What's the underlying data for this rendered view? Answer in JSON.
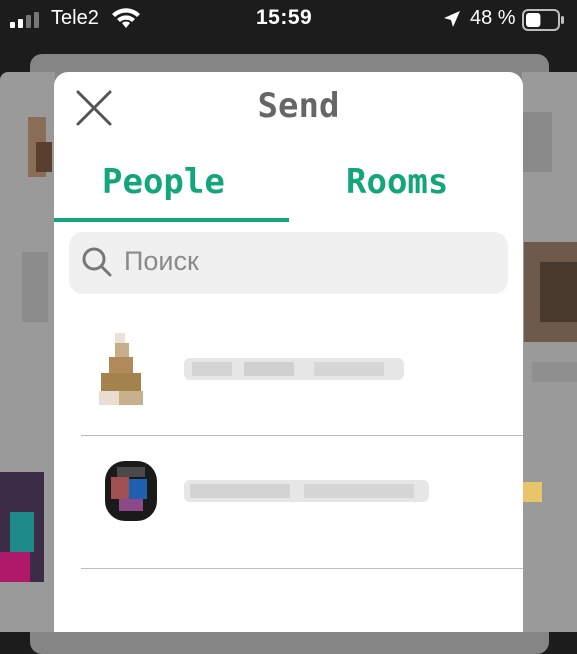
{
  "status_bar": {
    "carrier": "Tele2",
    "time": "15:59",
    "battery_percent": "48 %",
    "battery_level": 0.48
  },
  "modal": {
    "title": "Send",
    "tabs": [
      {
        "label": "People",
        "active": true
      },
      {
        "label": "Rooms",
        "active": false
      }
    ],
    "search": {
      "placeholder": "Поиск"
    },
    "contacts_count_visible": 2
  },
  "colors": {
    "accent": "#12a67a",
    "title_gray": "#666666"
  }
}
